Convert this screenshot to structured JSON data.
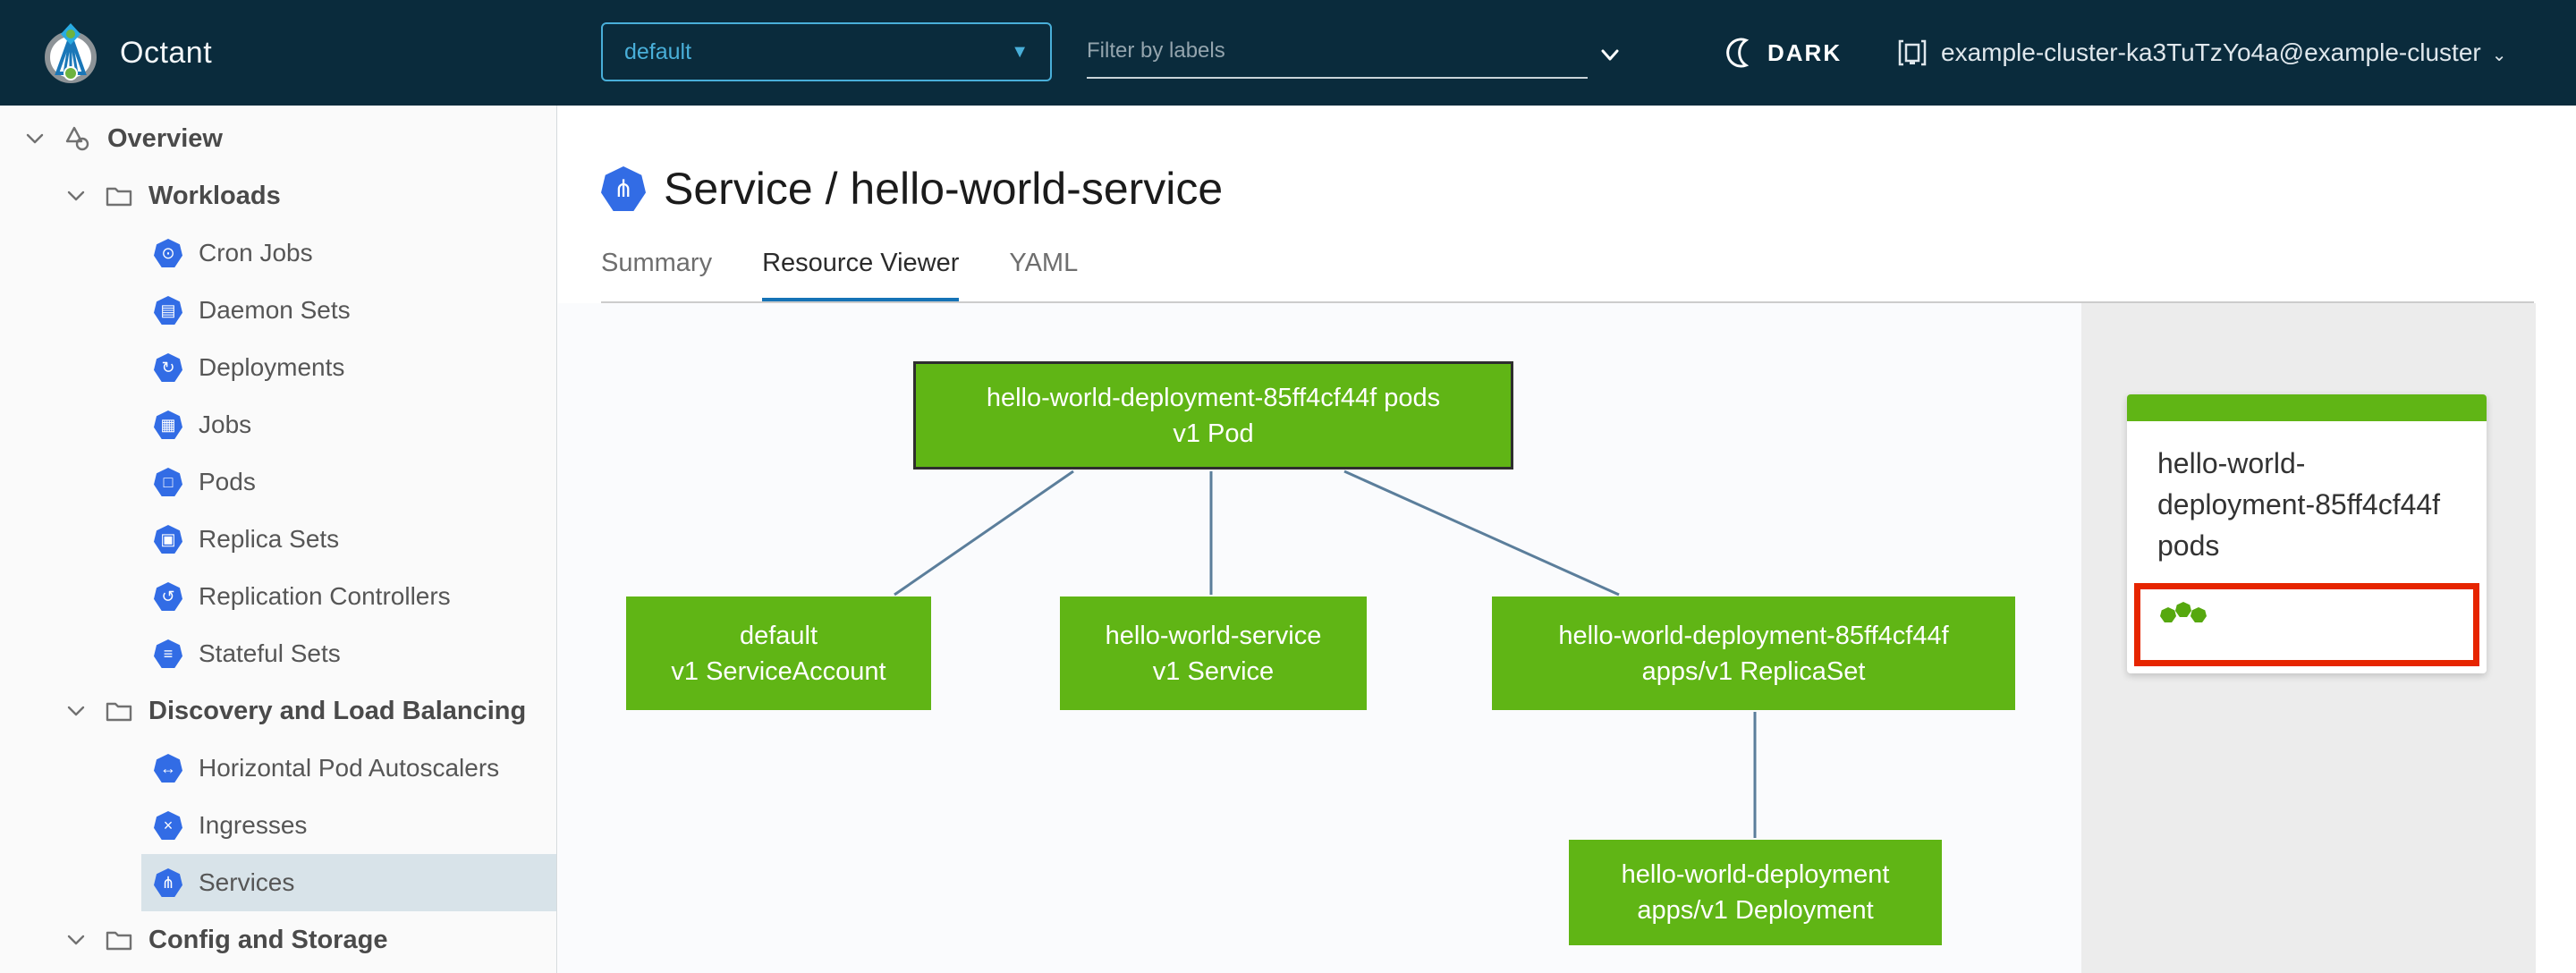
{
  "header": {
    "brand": "Octant",
    "namespace_dropdown": {
      "value": "default",
      "caret": "▼"
    },
    "filter": {
      "placeholder": "Filter by labels"
    },
    "theme_toggle": {
      "label": "DARK",
      "icon": "moon-icon"
    },
    "context_switcher": {
      "label": "example-cluster-ka3TuTzYo4a@example-cluster",
      "caret": "⌄",
      "icon": "cluster-icon"
    }
  },
  "sidebar": {
    "items": [
      {
        "label": "Overview",
        "level": 1,
        "icon": "objects-icon",
        "expanded": true
      },
      {
        "label": "Workloads",
        "level": 2,
        "icon": "folder-icon",
        "expanded": true
      },
      {
        "label": "Cron Jobs",
        "level": 3,
        "icon": "k8s-cronjob-icon",
        "glyph": "⊙"
      },
      {
        "label": "Daemon Sets",
        "level": 3,
        "icon": "k8s-daemonset-icon",
        "glyph": "▤"
      },
      {
        "label": "Deployments",
        "level": 3,
        "icon": "k8s-deployment-icon",
        "glyph": "↻"
      },
      {
        "label": "Jobs",
        "level": 3,
        "icon": "k8s-job-icon",
        "glyph": "▦"
      },
      {
        "label": "Pods",
        "level": 3,
        "icon": "k8s-pod-icon",
        "glyph": "□"
      },
      {
        "label": "Replica Sets",
        "level": 3,
        "icon": "k8s-replicaset-icon",
        "glyph": "▣"
      },
      {
        "label": "Replication Controllers",
        "level": 3,
        "icon": "k8s-replicationcontroller-icon",
        "glyph": "↺"
      },
      {
        "label": "Stateful Sets",
        "level": 3,
        "icon": "k8s-statefulset-icon",
        "glyph": "≡"
      },
      {
        "label": "Discovery and Load Balancing",
        "level": 2,
        "icon": "folder-icon",
        "expanded": true
      },
      {
        "label": "Horizontal Pod Autoscalers",
        "level": 3,
        "icon": "k8s-hpa-icon",
        "glyph": "↔"
      },
      {
        "label": "Ingresses",
        "level": 3,
        "icon": "k8s-ingress-icon",
        "glyph": "×"
      },
      {
        "label": "Services",
        "level": 3,
        "icon": "k8s-service-icon",
        "glyph": "⋔",
        "selected": true
      },
      {
        "label": "Config and Storage",
        "level": 2,
        "icon": "folder-icon",
        "expanded": true
      }
    ]
  },
  "main": {
    "title": {
      "text": "Service / hello-world-service",
      "kind_icon": "k8s-service-icon",
      "kind_glyph": "⋔"
    },
    "tabs": [
      {
        "label": "Summary",
        "active": false
      },
      {
        "label": "Resource Viewer",
        "active": true
      },
      {
        "label": "YAML",
        "active": false
      }
    ]
  },
  "graph": {
    "nodes": [
      {
        "id": "pod",
        "line1": "hello-world-deployment-85ff4cf44f pods",
        "line2": "v1 Pod",
        "selected": true
      },
      {
        "id": "serviceaccount",
        "line1": "default",
        "line2": "v1 ServiceAccount",
        "selected": false
      },
      {
        "id": "service",
        "line1": "hello-world-service",
        "line2": "v1 Service",
        "selected": false
      },
      {
        "id": "replicaset",
        "line1": "hello-world-deployment-85ff4cf44f",
        "line2": "apps/v1 ReplicaSet",
        "selected": false
      },
      {
        "id": "deployment",
        "line1": "hello-world-deployment",
        "line2": "apps/v1 Deployment",
        "selected": false
      }
    ],
    "edges": [
      {
        "from": "pod",
        "to": "serviceaccount"
      },
      {
        "from": "pod",
        "to": "service"
      },
      {
        "from": "pod",
        "to": "replicaset"
      },
      {
        "from": "replicaset",
        "to": "deployment"
      }
    ]
  },
  "detail_panel": {
    "card": {
      "title": "hello-world-deployment-85ff4cf44f pods",
      "pod_status_dots": 3
    }
  },
  "colors": {
    "header_bg": "#0a2b3c",
    "accent_blue": "#49afd9",
    "k8s_blue": "#326ce5",
    "node_green": "#60b515",
    "edge_blue": "#5b7e9b",
    "tab_active_underline": "#1573b6",
    "nav_selected_bg": "#d8e3e9",
    "alert_red": "#e62500",
    "selected_node_border": "#2e2e2e"
  }
}
